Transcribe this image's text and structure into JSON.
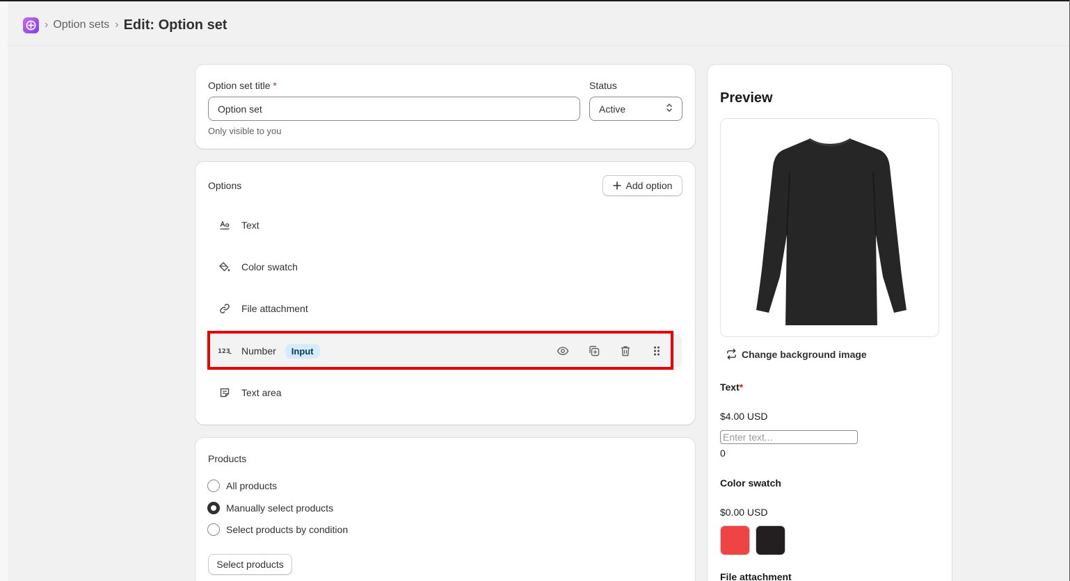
{
  "breadcrumb": {
    "parent": "Option sets",
    "sep1": "›",
    "sep2": "›",
    "current": "Edit: Option set"
  },
  "title_card": {
    "title_label": "Option set title",
    "required_mark": "*",
    "title_value": "Option set",
    "help_text": "Only visible to you",
    "status_label": "Status",
    "status_value": "Active"
  },
  "options_card": {
    "heading": "Options",
    "add_button": "Add option",
    "items": [
      {
        "label": "Text",
        "icon": "text-format-icon"
      },
      {
        "label": "Color swatch",
        "icon": "paint-bucket-icon"
      },
      {
        "label": "File attachment",
        "icon": "link-icon"
      },
      {
        "label": "Number",
        "icon": "number-icon",
        "badge": "Input"
      },
      {
        "label": "Text area",
        "icon": "note-icon"
      }
    ]
  },
  "products_card": {
    "heading": "Products",
    "radios": [
      {
        "label": "All products",
        "checked": false
      },
      {
        "label": "Manually select products",
        "checked": true
      },
      {
        "label": "Select products by condition",
        "checked": false
      }
    ],
    "select_button": "Select products"
  },
  "preview": {
    "title": "Preview",
    "change_bg": "Change background image",
    "text_label": "Text",
    "required_mark": "*",
    "text_price": "$4.00 USD",
    "text_placeholder": "Enter text...",
    "text_count": "0",
    "swatch_label": "Color swatch",
    "swatch_price": "$0.00 USD",
    "swatches": [
      "#ef4444",
      "#231f20"
    ],
    "file_label": "File attachment"
  },
  "colors": {
    "accent_badge_bg": "#d5ebff",
    "highlight": "#e60000"
  }
}
